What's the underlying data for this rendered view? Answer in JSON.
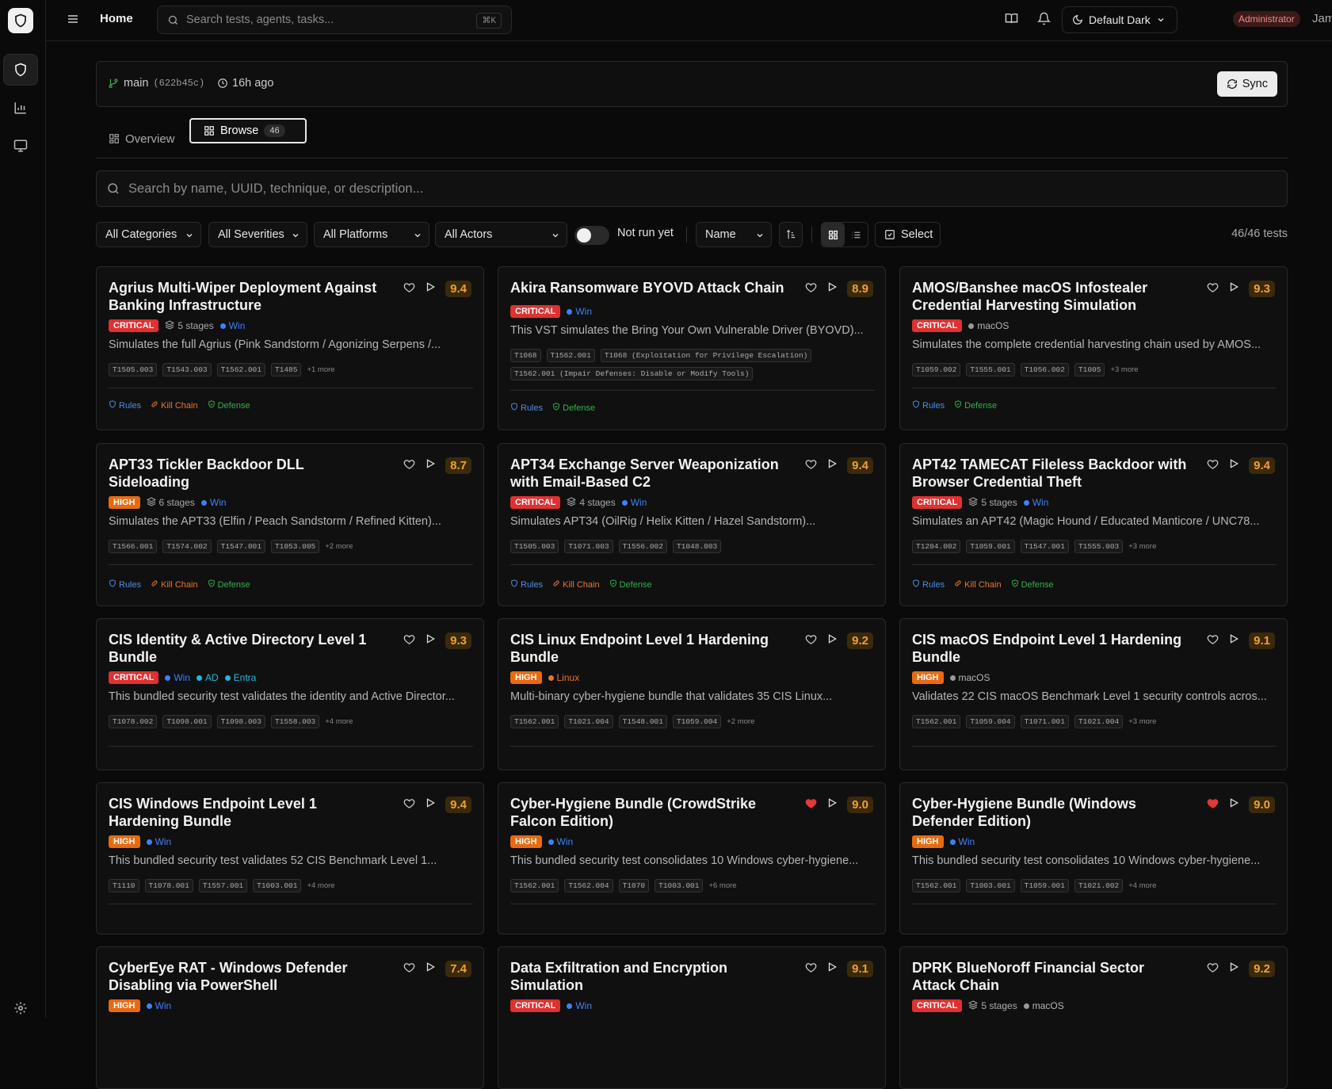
{
  "topbar": {
    "home": "Home",
    "search_placeholder": "Search tests, agents, tasks...",
    "shortcut": "⌘K",
    "theme": "Default Dark",
    "role": "Administrator",
    "user": "James"
  },
  "branch": {
    "name": "main",
    "hash": "(622b45c)",
    "ago": "16h ago",
    "sync": "Sync"
  },
  "tabs": {
    "overview": "Overview",
    "browse": "Browse",
    "browse_count": "46"
  },
  "browse": {
    "search_placeholder": "Search by name, UUID, technique, or description...",
    "filters": {
      "categories": "All Categories",
      "severities": "All Severities",
      "platforms": "All Platforms",
      "actors": "All Actors",
      "not_run": "Not run yet",
      "sort": "Name",
      "select": "Select",
      "count": "46/46 tests"
    }
  },
  "cards": [
    {
      "title": "Agrius Multi-Wiper Deployment Against Banking Infrastructure",
      "score": "9.4",
      "sev": "CRITICAL",
      "stages": "5 stages",
      "plats": [
        {
          "n": "Win",
          "c": "#3b82f6"
        }
      ],
      "desc": "Simulates the full Agrius (Pink Sandstorm / Agonizing Serpens /...",
      "tags": [
        "T1505.003",
        "T1543.003",
        "T1562.001",
        "T1485"
      ],
      "more": "+1 more",
      "links": [
        "Rules",
        "Kill Chain",
        "Defense"
      ],
      "fav": false
    },
    {
      "title": "Akira Ransomware BYOVD Attack Chain",
      "score": "8.9",
      "sev": "CRITICAL",
      "stages": "",
      "plats": [
        {
          "n": "Win",
          "c": "#3b82f6"
        }
      ],
      "desc": "This VST simulates the Bring Your Own Vulnerable Driver (BYOVD)...",
      "tags": [
        "T1068",
        "T1562.001",
        "T1068 (Exploitation for Privilege Escalation)",
        "T1562.001 (Impair Defenses: Disable or Modify Tools)"
      ],
      "more": "",
      "links": [
        "Rules",
        "Defense"
      ],
      "fav": false
    },
    {
      "title": "AMOS/Banshee macOS Infostealer Credential Harvesting Simulation",
      "score": "9.3",
      "sev": "CRITICAL",
      "stages": "",
      "plats": [
        {
          "n": "macOS",
          "c": "#9a9a9a"
        }
      ],
      "desc": "Simulates the complete credential harvesting chain used by AMOS...",
      "tags": [
        "T1059.002",
        "T1555.001",
        "T1056.002",
        "T1005"
      ],
      "more": "+3 more",
      "links": [
        "Rules",
        "Defense"
      ],
      "fav": false
    },
    {
      "title": "APT33 Tickler Backdoor DLL Sideloading",
      "score": "8.7",
      "sev": "HIGH",
      "stages": "6 stages",
      "plats": [
        {
          "n": "Win",
          "c": "#3b82f6"
        }
      ],
      "desc": "Simulates the APT33 (Elfin / Peach Sandstorm / Refined Kitten)...",
      "tags": [
        "T1566.001",
        "T1574.002",
        "T1547.001",
        "T1053.005"
      ],
      "more": "+2 more",
      "links": [
        "Rules",
        "Kill Chain",
        "Defense"
      ],
      "fav": false
    },
    {
      "title": "APT34 Exchange Server Weaponization with Email-Based C2",
      "score": "9.4",
      "sev": "CRITICAL",
      "stages": "4 stages",
      "plats": [
        {
          "n": "Win",
          "c": "#3b82f6"
        }
      ],
      "desc": "Simulates APT34 (OilRig / Helix Kitten / Hazel Sandstorm)...",
      "tags": [
        "T1505.003",
        "T1071.003",
        "T1556.002",
        "T1048.003"
      ],
      "more": "",
      "links": [
        "Rules",
        "Kill Chain",
        "Defense"
      ],
      "fav": false
    },
    {
      "title": "APT42 TAMECAT Fileless Backdoor with Browser Credential Theft",
      "score": "9.4",
      "sev": "CRITICAL",
      "stages": "5 stages",
      "plats": [
        {
          "n": "Win",
          "c": "#3b82f6"
        }
      ],
      "desc": "Simulates an APT42 (Magic Hound / Educated Manticore / UNC78...",
      "tags": [
        "T1204.002",
        "T1059.001",
        "T1547.001",
        "T1555.003"
      ],
      "more": "+3 more",
      "links": [
        "Rules",
        "Kill Chain",
        "Defense"
      ],
      "fav": false
    },
    {
      "title": "CIS Identity & Active Directory Level 1 Bundle",
      "score": "9.3",
      "sev": "CRITICAL",
      "stages": "",
      "plats": [
        {
          "n": "Win",
          "c": "#3b82f6"
        },
        {
          "n": "AD",
          "c": "#22b8e0"
        },
        {
          "n": "Entra",
          "c": "#22b8e0"
        }
      ],
      "desc": "This bundled security test validates the identity and Active Director...",
      "tags": [
        "T1078.002",
        "T1098.001",
        "T1098.003",
        "T1558.003"
      ],
      "more": "+4 more",
      "links": [],
      "fav": false
    },
    {
      "title": "CIS Linux Endpoint Level 1 Hardening Bundle",
      "score": "9.2",
      "sev": "HIGH",
      "stages": "",
      "plats": [
        {
          "n": "Linux",
          "c": "#e8762a"
        }
      ],
      "desc": "Multi-binary cyber-hygiene bundle that validates 35 CIS Linux...",
      "tags": [
        "T1562.001",
        "T1021.004",
        "T1548.001",
        "T1059.004"
      ],
      "more": "+2 more",
      "links": [],
      "fav": false
    },
    {
      "title": "CIS macOS Endpoint Level 1 Hardening Bundle",
      "score": "9.1",
      "sev": "HIGH",
      "stages": "",
      "plats": [
        {
          "n": "macOS",
          "c": "#9a9a9a"
        }
      ],
      "desc": "Validates 22 CIS macOS Benchmark Level 1 security controls acros...",
      "tags": [
        "T1562.001",
        "T1059.004",
        "T1071.001",
        "T1021.004"
      ],
      "more": "+3 more",
      "links": [],
      "fav": false
    },
    {
      "title": "CIS Windows Endpoint Level 1 Hardening Bundle",
      "score": "9.4",
      "sev": "HIGH",
      "stages": "",
      "plats": [
        {
          "n": "Win",
          "c": "#3b82f6"
        }
      ],
      "desc": "This bundled security test validates 52 CIS Benchmark Level 1...",
      "tags": [
        "T1110",
        "T1078.001",
        "T1557.001",
        "T1003.001"
      ],
      "more": "+4 more",
      "links": [],
      "fav": false
    },
    {
      "title": "Cyber-Hygiene Bundle (CrowdStrike Falcon Edition)",
      "score": "9.0",
      "sev": "HIGH",
      "stages": "",
      "plats": [
        {
          "n": "Win",
          "c": "#3b82f6"
        }
      ],
      "desc": "This bundled security test consolidates 10 Windows cyber-hygiene...",
      "tags": [
        "T1562.001",
        "T1562.004",
        "T1070",
        "T1003.001"
      ],
      "more": "+6 more",
      "links": [],
      "fav": true
    },
    {
      "title": "Cyber-Hygiene Bundle (Windows Defender Edition)",
      "score": "9.0",
      "sev": "HIGH",
      "stages": "",
      "plats": [
        {
          "n": "Win",
          "c": "#3b82f6"
        }
      ],
      "desc": "This bundled security test consolidates 10 Windows cyber-hygiene...",
      "tags": [
        "T1562.001",
        "T1003.001",
        "T1059.001",
        "T1021.002"
      ],
      "more": "+4 more",
      "links": [],
      "fav": true
    },
    {
      "title": "CyberEye RAT - Windows Defender Disabling via PowerShell",
      "score": "7.4",
      "sev": "HIGH",
      "stages": "",
      "plats": [
        {
          "n": "Win",
          "c": "#3b82f6"
        }
      ],
      "desc": "",
      "tags": [],
      "more": "",
      "links": [],
      "fav": false
    },
    {
      "title": "Data Exfiltration and Encryption Simulation",
      "score": "9.1",
      "sev": "CRITICAL",
      "stages": "",
      "plats": [
        {
          "n": "Win",
          "c": "#3b82f6"
        }
      ],
      "desc": "",
      "tags": [],
      "more": "",
      "links": [],
      "fav": false
    },
    {
      "title": "DPRK BlueNoroff Financial Sector Attack Chain",
      "score": "9.2",
      "sev": "CRITICAL",
      "stages": "5 stages",
      "plats": [
        {
          "n": "macOS",
          "c": "#9a9a9a"
        }
      ],
      "desc": "",
      "tags": [],
      "more": "",
      "links": [],
      "fav": false
    }
  ]
}
